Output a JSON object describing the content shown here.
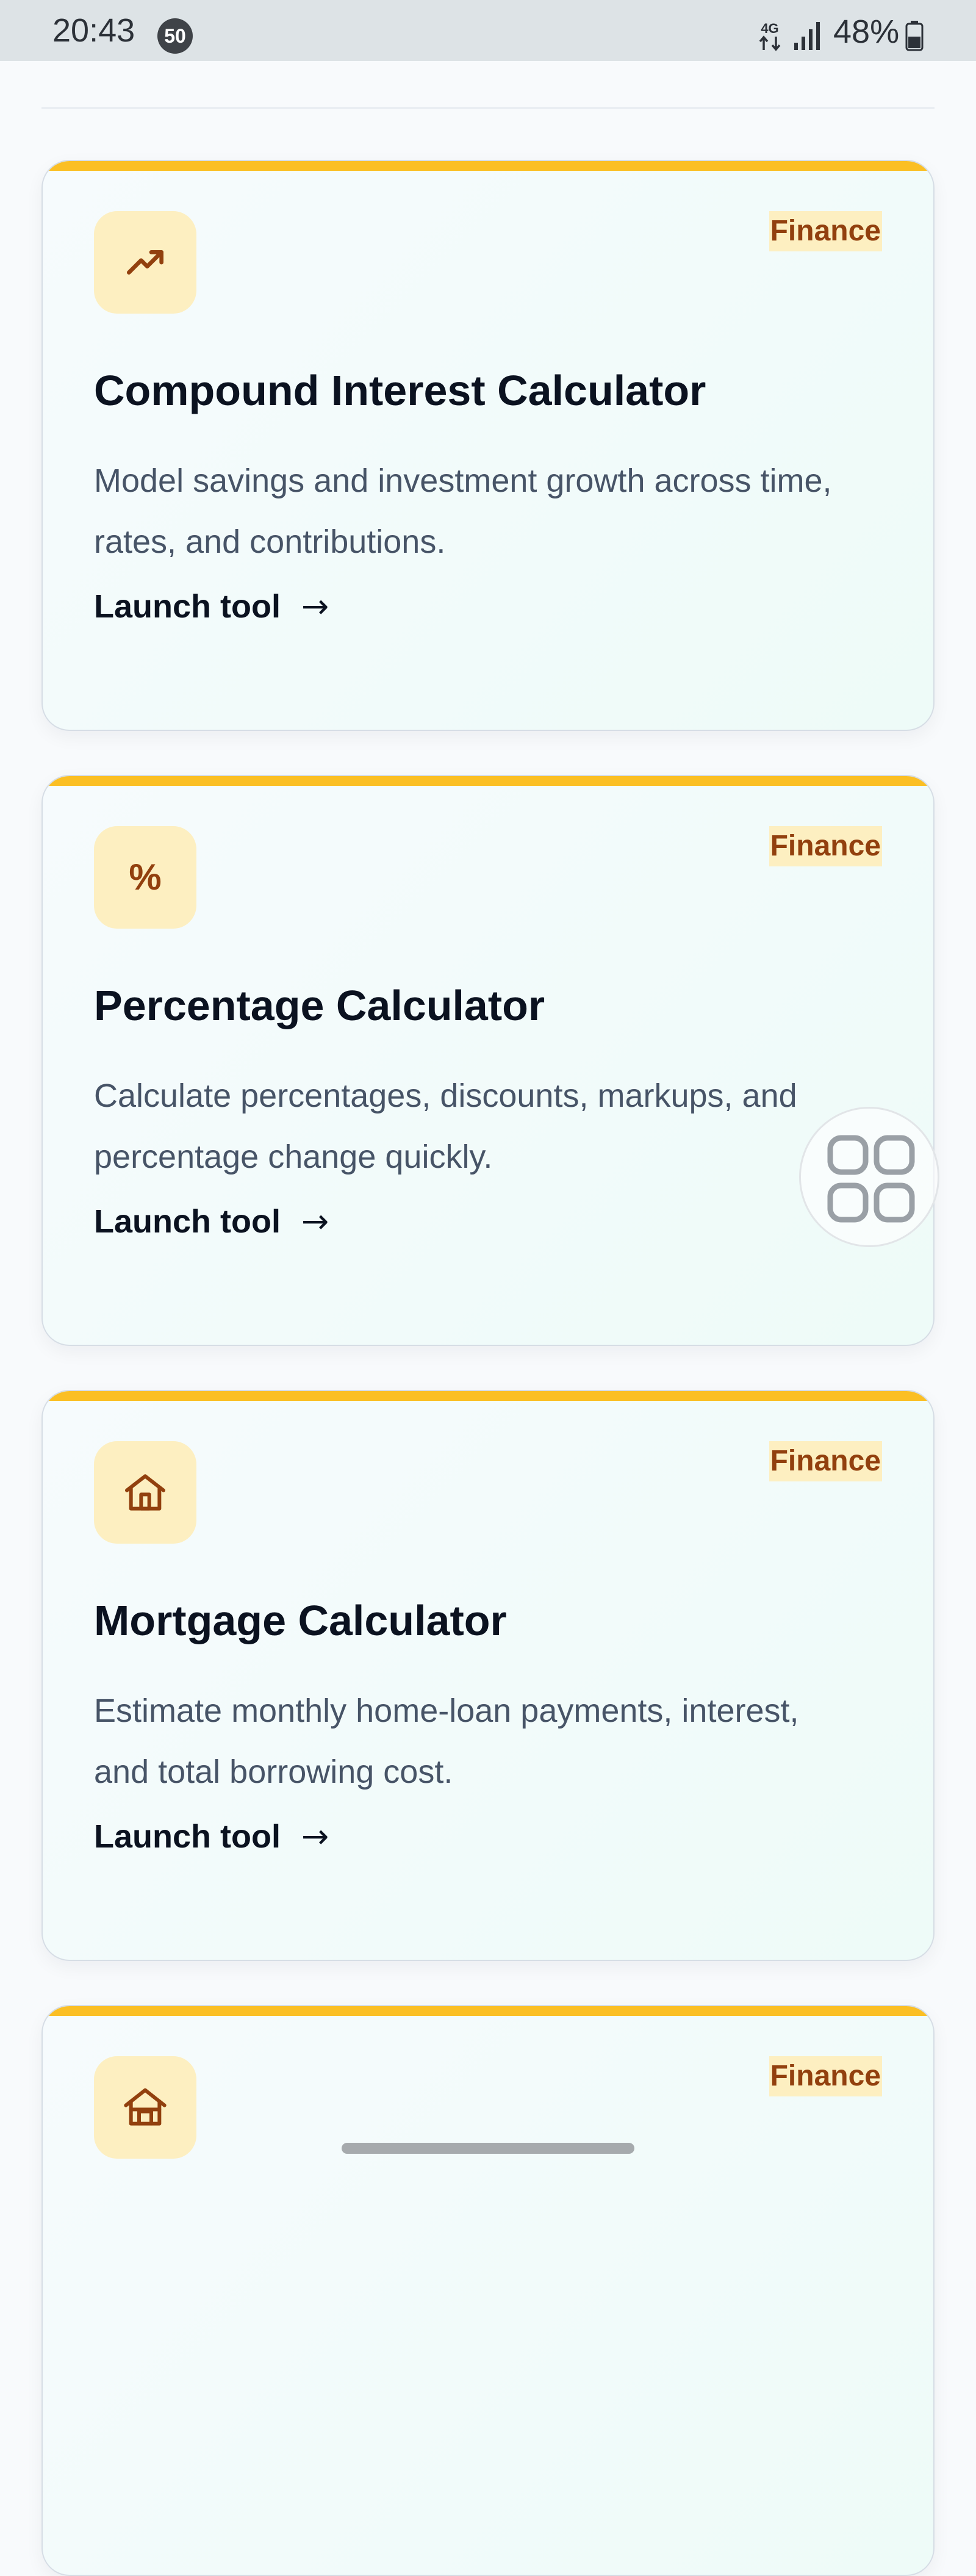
{
  "status_bar": {
    "time": "20:43",
    "notification_count": "50",
    "network_type": "4G",
    "battery": "48%"
  },
  "colors": {
    "accent_bar": "#fbbf24",
    "icon_background": "#fdefc1",
    "icon_color": "#92400e",
    "title_color": "#0b1220",
    "description_color": "#475467"
  },
  "cards": [
    {
      "icon": "trending-up-icon",
      "badge": "Finance",
      "title": "Compound Interest Calculator",
      "description": "Model savings and investment growth across time, rates, and contributions.",
      "link": "Launch tool",
      "link_arrow": "→"
    },
    {
      "icon": "percent-icon",
      "icon_glyph": "%",
      "badge": "Finance",
      "title": "Percentage Calculator",
      "description": "Calculate percentages, discounts, markups, and percentage change quickly.",
      "link": "Launch tool",
      "link_arrow": "→"
    },
    {
      "icon": "home-icon",
      "badge": "Finance",
      "title": "Mortgage Calculator",
      "description": "Estimate monthly home-loan payments, interest, and total borrowing cost.",
      "link": "Launch tool",
      "link_arrow": "→"
    },
    {
      "icon": "house-icon",
      "badge": "Finance"
    }
  ],
  "floating_button": {
    "icon": "apps-grid-icon"
  }
}
